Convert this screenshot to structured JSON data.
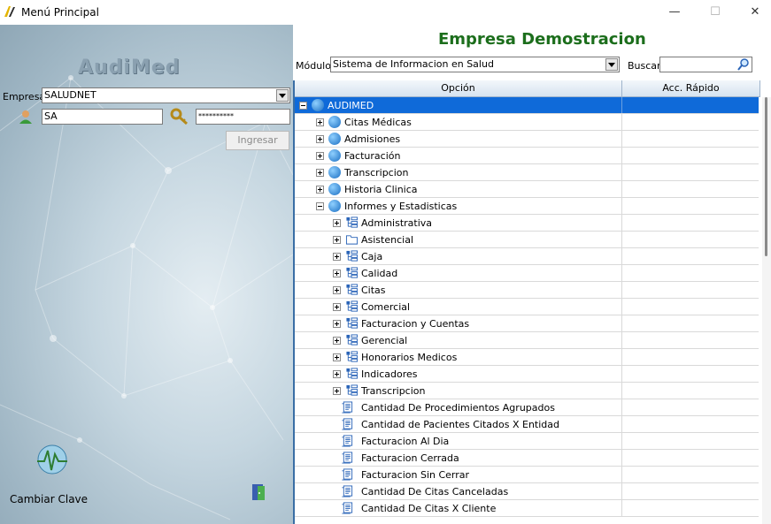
{
  "window": {
    "title": "Menú Principal",
    "minimize": "—",
    "maximize": "☐",
    "close": "✕"
  },
  "login": {
    "logo": "AudiMed",
    "empresa_label": "Empresa",
    "empresa_value": "SALUDNET",
    "user_value": "SA",
    "password_value": "**********",
    "ingresar_label": "Ingresar",
    "cambiar_clave_label": "Cambiar Clave"
  },
  "header": {
    "empresa_title": "Empresa Demostracion",
    "modulo_label": "Módulo",
    "modulo_value": "Sistema de Informacion en Salud",
    "buscar_label": "Buscar",
    "buscar_value": ""
  },
  "tree": {
    "col_opcion": "Opción",
    "col_acceso": "Acc. Rápido",
    "rows": [
      {
        "label": "AUDIMED",
        "level": 0,
        "icon": "globe",
        "expander": "minus",
        "selected": true
      },
      {
        "label": "Citas Médicas",
        "level": 1,
        "icon": "globe",
        "expander": "plus"
      },
      {
        "label": "Admisiones",
        "level": 1,
        "icon": "globe",
        "expander": "plus"
      },
      {
        "label": "Facturación",
        "level": 1,
        "icon": "globe",
        "expander": "plus"
      },
      {
        "label": "Transcripcion",
        "level": 1,
        "icon": "globe",
        "expander": "plus"
      },
      {
        "label": "Historia Clinica",
        "level": 1,
        "icon": "globe",
        "expander": "plus"
      },
      {
        "label": "Informes y Estadisticas",
        "level": 1,
        "icon": "globe",
        "expander": "minus"
      },
      {
        "label": "Administrativa",
        "level": 2,
        "icon": "tree",
        "expander": "plus"
      },
      {
        "label": "Asistencial",
        "level": 2,
        "icon": "folder",
        "expander": "plus"
      },
      {
        "label": "Caja",
        "level": 2,
        "icon": "tree",
        "expander": "plus"
      },
      {
        "label": "Calidad",
        "level": 2,
        "icon": "tree",
        "expander": "plus"
      },
      {
        "label": "Citas",
        "level": 2,
        "icon": "tree",
        "expander": "plus"
      },
      {
        "label": "Comercial",
        "level": 2,
        "icon": "tree",
        "expander": "plus"
      },
      {
        "label": "Facturacion y Cuentas",
        "level": 2,
        "icon": "tree",
        "expander": "plus"
      },
      {
        "label": "Gerencial",
        "level": 2,
        "icon": "tree",
        "expander": "plus"
      },
      {
        "label": "Honorarios Medicos",
        "level": 2,
        "icon": "tree",
        "expander": "plus"
      },
      {
        "label": "Indicadores",
        "level": 2,
        "icon": "tree",
        "expander": "plus"
      },
      {
        "label": "Transcripcion",
        "level": 2,
        "icon": "tree",
        "expander": "plus"
      },
      {
        "label": "Cantidad De Procedimientos Agrupados",
        "level": 2,
        "icon": "report",
        "expander": "none"
      },
      {
        "label": "Cantidad de Pacientes Citados X Entidad",
        "level": 2,
        "icon": "report",
        "expander": "none"
      },
      {
        "label": "Facturacion Al Dia",
        "level": 2,
        "icon": "report",
        "expander": "none"
      },
      {
        "label": "Facturacion Cerrada",
        "level": 2,
        "icon": "report",
        "expander": "none"
      },
      {
        "label": "Facturacion Sin Cerrar",
        "level": 2,
        "icon": "report",
        "expander": "none"
      },
      {
        "label": "Cantidad De Citas Canceladas",
        "level": 2,
        "icon": "report",
        "expander": "none"
      },
      {
        "label": "Cantidad De Citas X Cliente",
        "level": 2,
        "icon": "report",
        "expander": "none"
      }
    ]
  },
  "colors": {
    "selection": "#0f6ad9",
    "title_green": "#1c6e1c",
    "border_blue": "#3a6ea5"
  }
}
